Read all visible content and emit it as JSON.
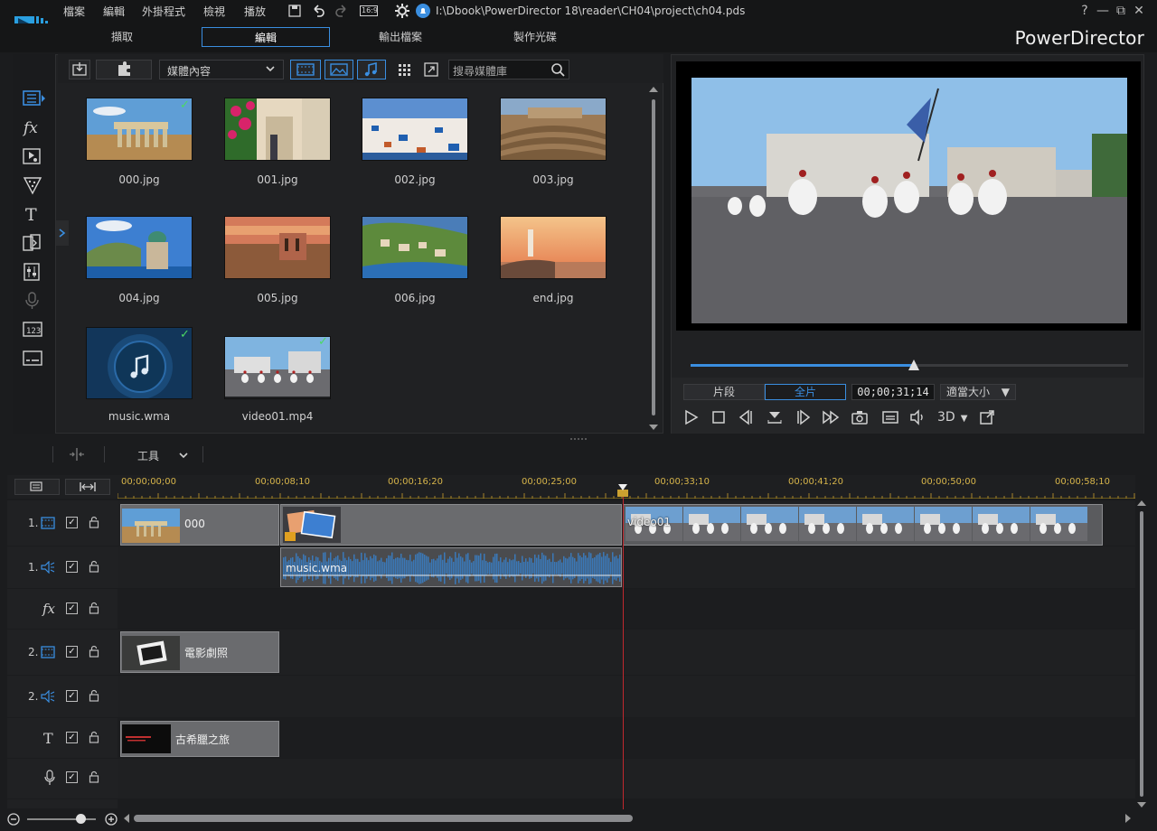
{
  "app": {
    "brand": "PowerDirector",
    "menu": [
      "檔案",
      "編輯",
      "外掛程式",
      "檢視",
      "播放"
    ],
    "aspect_badge": "16:9",
    "project_path": "I:\\Dbook\\PowerDirector 18\\reader\\CH04\\project\\ch04.pds",
    "window_buttons": [
      "?",
      "—",
      "⧉",
      "✕"
    ]
  },
  "mode_tabs": [
    {
      "label": "擷取",
      "active": false
    },
    {
      "label": "編輯",
      "active": true
    },
    {
      "label": "輸出檔案",
      "active": false
    },
    {
      "label": "製作光碟",
      "active": false
    }
  ],
  "library": {
    "dropdown": "媒體內容",
    "search_placeholder": "搜尋媒體庫",
    "items": [
      {
        "name": "000.jpg",
        "checked": true
      },
      {
        "name": "001.jpg",
        "checked": false
      },
      {
        "name": "002.jpg",
        "checked": false
      },
      {
        "name": "003.jpg",
        "checked": false
      },
      {
        "name": "004.jpg",
        "checked": false
      },
      {
        "name": "005.jpg",
        "checked": false
      },
      {
        "name": "006.jpg",
        "checked": false
      },
      {
        "name": "end.jpg",
        "checked": false
      },
      {
        "name": "music.wma",
        "checked": true
      },
      {
        "name": "video01.mp4",
        "checked": true
      }
    ]
  },
  "preview": {
    "mode_clip": "片段",
    "mode_movie": "全片",
    "timecode": "00;00;31;14",
    "fit": "適當大小",
    "stereo": "3D",
    "progress_fraction": 0.51
  },
  "toolbar": {
    "tools_label": "工具"
  },
  "timeline": {
    "ruler_labels": [
      "00;00;00;00",
      "00;00;08;10",
      "00;00;16;20",
      "00;00;25;00",
      "00;00;33;10",
      "00;00;41;20",
      "00;00;50;00",
      "00;00;58;10"
    ],
    "tracks": [
      {
        "num": "1.",
        "type": "video"
      },
      {
        "num": "1.",
        "type": "audio"
      },
      {
        "num": "",
        "type": "fx"
      },
      {
        "num": "2.",
        "type": "video"
      },
      {
        "num": "2.",
        "type": "audio"
      },
      {
        "num": "",
        "type": "title"
      },
      {
        "num": "",
        "type": "voice"
      }
    ],
    "clips": {
      "v1_a": "000",
      "v1_c": "video01",
      "a1": "music.wma",
      "v2": "電影劇照",
      "title": "古希臘之旅"
    }
  },
  "colors": {
    "accent": "#3a8ee0",
    "playhead": "#c0282e",
    "ruler": "#d6b44a",
    "check": "#4cd964"
  }
}
